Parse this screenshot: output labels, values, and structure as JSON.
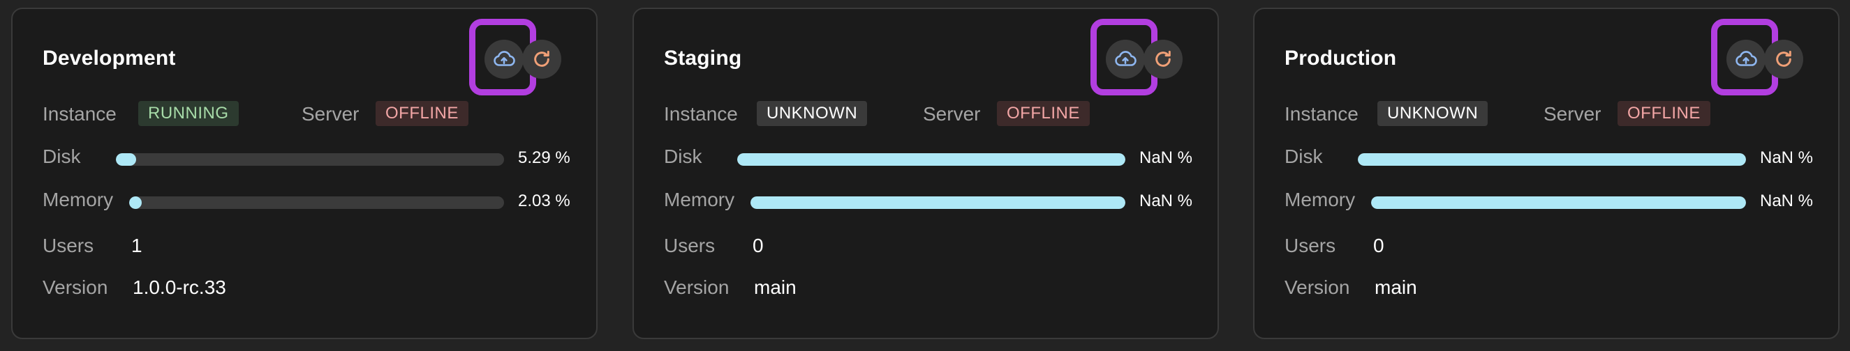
{
  "labels": {
    "instance": "Instance",
    "server": "Server",
    "disk": "Disk",
    "memory": "Memory",
    "users": "Users",
    "version": "Version"
  },
  "colors": {
    "bar_fill": "#aee8f6",
    "running_text": "#a7dba8",
    "offline_text": "#f2a6a6",
    "upload_icon": "#8fb7f0",
    "refresh_icon": "#f0a077",
    "highlight": "#b23ee0"
  },
  "icons": {
    "upload": "cloud-upload-icon",
    "refresh": "refresh-icon"
  },
  "cards": [
    {
      "title": "Development",
      "instance_status": "RUNNING",
      "server_status": "OFFLINE",
      "disk_pct_text": "5.29 %",
      "disk_fraction": 0.0529,
      "memory_pct_text": "2.03 %",
      "memory_fraction": 0.0203,
      "users": "1",
      "version": "1.0.0-rc.33"
    },
    {
      "title": "Staging",
      "instance_status": "UNKNOWN",
      "server_status": "OFFLINE",
      "disk_pct_text": "NaN %",
      "disk_fraction": 1,
      "memory_pct_text": "NaN %",
      "memory_fraction": 1,
      "users": "0",
      "version": "main"
    },
    {
      "title": "Production",
      "instance_status": "UNKNOWN",
      "server_status": "OFFLINE",
      "disk_pct_text": "NaN %",
      "disk_fraction": 1,
      "memory_pct_text": "NaN %",
      "memory_fraction": 1,
      "users": "0",
      "version": "main"
    }
  ]
}
